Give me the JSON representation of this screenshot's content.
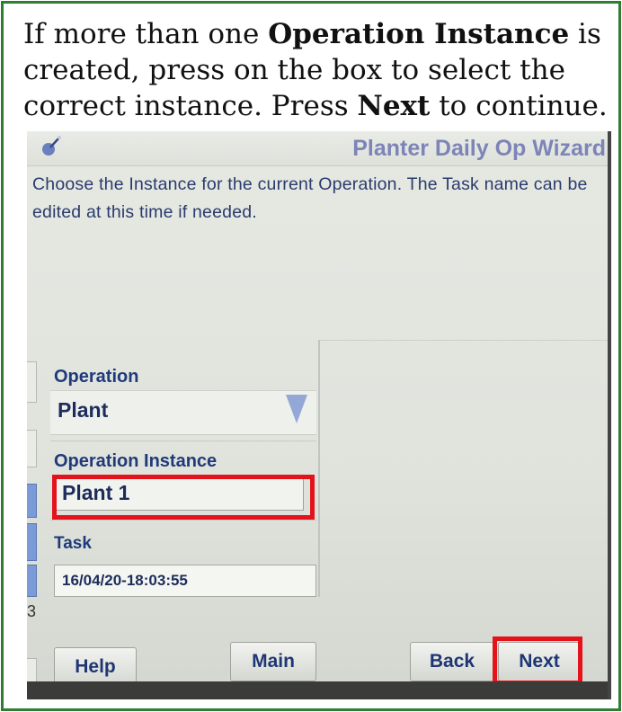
{
  "instruction": {
    "line1_prefix": "If more than one ",
    "line1_bold": "Operation Instance",
    "line1_suffix": " is",
    "line2": "created, press on the box to select the",
    "line3_prefix": "correct instance. Press ",
    "line3_bold": "Next",
    "line3_suffix": " to continue."
  },
  "screen": {
    "title": "Planter Daily Op Wizard",
    "description": "Choose the Instance for the current Operation. The Task name can be edited at this time if needed.",
    "fields": {
      "operation_label": "Operation",
      "operation_value": "Plant",
      "instance_label": "Operation Instance",
      "instance_value": "Plant 1",
      "task_label": "Task",
      "task_value": "16/04/20-18:03:55"
    },
    "edge_digit": "3",
    "buttons": {
      "help": "Help",
      "main": "Main",
      "back": "Back",
      "next": "Next"
    }
  },
  "colors": {
    "frame_border": "#2e7d32",
    "highlight": "#e3121b",
    "title_text": "#7d84b7",
    "label_text": "#203a7a"
  }
}
